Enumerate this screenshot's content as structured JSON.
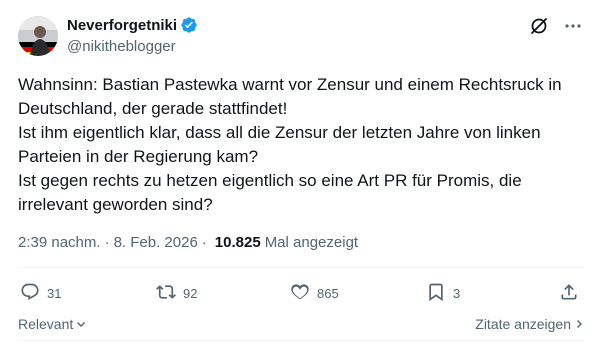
{
  "author": {
    "display_name": "Neverforgetniki",
    "handle": "@nikitheblogger",
    "verified_color": "#1d9bf0"
  },
  "top_actions": {
    "grok_icon": "slash-circle-icon",
    "more_icon": "more-icon"
  },
  "post": {
    "lines": [
      "Wahnsinn: Bastian Pastewka warnt vor Zensur und einem Rechtsruck in Deutschland, der gerade stattfindet!",
      "Ist ihm eigentlich klar, dass all die Zensur der letzten Jahre von linken Parteien in der Regierung kam?",
      "Ist gegen rechts zu hetzen eigentlich so eine Art PR für Promis, die irrelevant geworden sind?"
    ]
  },
  "meta": {
    "time": "2:39 nachm.",
    "separator": "·",
    "date": "8. Feb. 2026",
    "separator2": "·",
    "views_count": "10.825",
    "views_label": "Mal angezeigt"
  },
  "actions": {
    "replies": "31",
    "reposts": "92",
    "likes": "865",
    "bookmarks": "3"
  },
  "footer": {
    "sort_label": "Relevant",
    "quotes_label": "Zitate anzeigen"
  }
}
